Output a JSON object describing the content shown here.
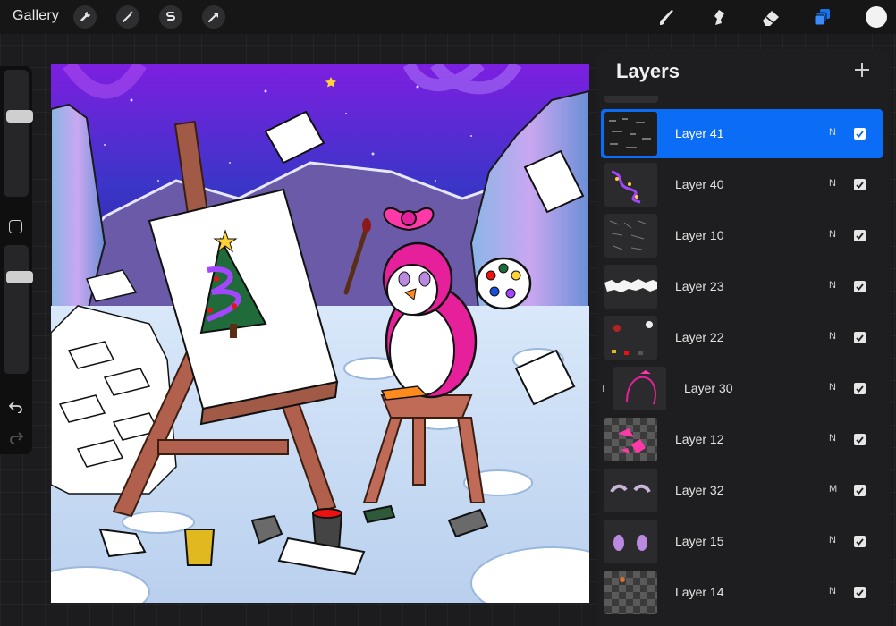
{
  "app": {
    "gallery_label": "Gallery",
    "top_tools": [
      "wrench-icon",
      "magic-wand-icon",
      "selection-icon",
      "transform-arrow-icon"
    ],
    "right_tools": [
      "brush-icon",
      "smudge-icon",
      "eraser-icon",
      "layers-icon"
    ],
    "active_color": "#f2f2f2",
    "accent": "#0b6cf5"
  },
  "sidebar": {
    "brush_size": 0.65,
    "opacity": 0.78
  },
  "layers": {
    "title": "Layers",
    "add_label": "+",
    "items": [
      {
        "name": "Layer 41",
        "blend": "N",
        "visible": true,
        "active": true,
        "clipped": false
      },
      {
        "name": "Layer 40",
        "blend": "N",
        "visible": true,
        "active": false,
        "clipped": false
      },
      {
        "name": "Layer 10",
        "blend": "N",
        "visible": true,
        "active": false,
        "clipped": false
      },
      {
        "name": "Layer 23",
        "blend": "N",
        "visible": true,
        "active": false,
        "clipped": false
      },
      {
        "name": "Layer 22",
        "blend": "N",
        "visible": true,
        "active": false,
        "clipped": false
      },
      {
        "name": "Layer 30",
        "blend": "N",
        "visible": true,
        "active": false,
        "clipped": true
      },
      {
        "name": "Layer 12",
        "blend": "N",
        "visible": true,
        "active": false,
        "clipped": false
      },
      {
        "name": "Layer 32",
        "blend": "M",
        "visible": true,
        "active": false,
        "clipped": false
      },
      {
        "name": "Layer 15",
        "blend": "N",
        "visible": true,
        "active": false,
        "clipped": false
      },
      {
        "name": "Layer 14",
        "blend": "N",
        "visible": true,
        "active": false,
        "clipped": false
      }
    ]
  }
}
